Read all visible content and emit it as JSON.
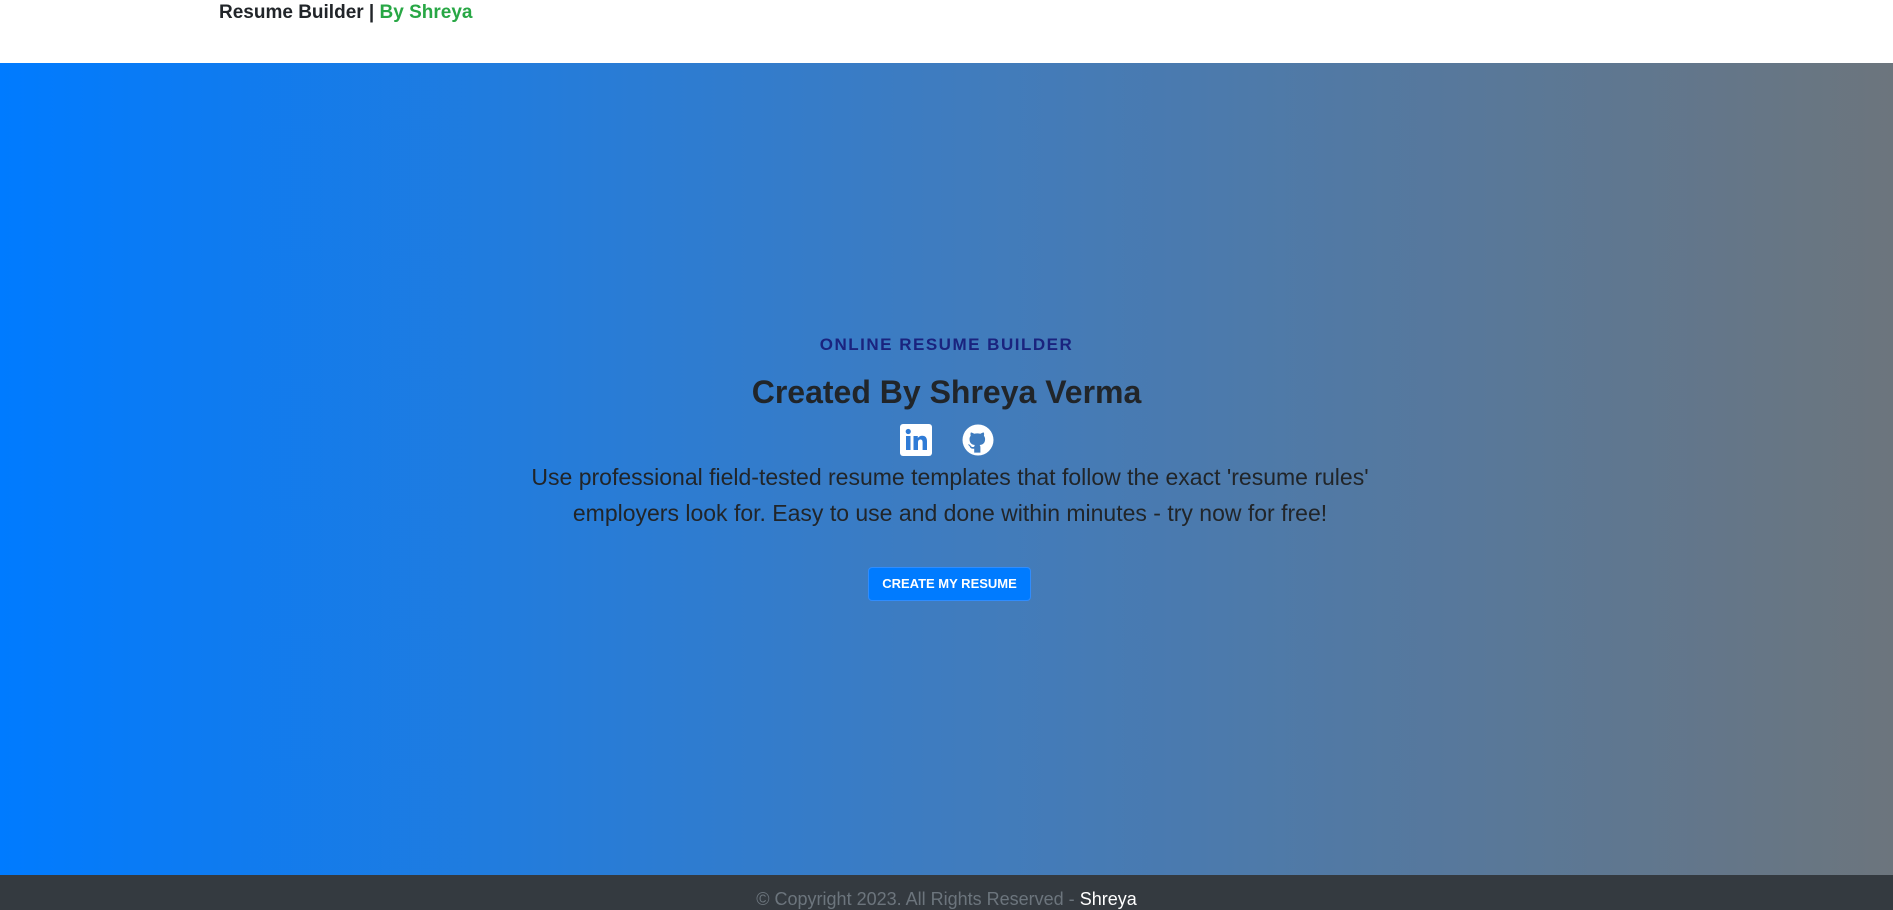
{
  "navbar": {
    "brand_main": "Resume Builder | ",
    "brand_accent": "By Shreya"
  },
  "hero": {
    "eyebrow": "ONLINE RESUME BUILDER",
    "headline": "Created By Shreya Verma",
    "description_line1": "Use professional field-tested resume templates that follow the exact 'resume rules'",
    "description_line2": "employers look for. Easy to use and done within minutes - try now for free!",
    "cta_label": "CREATE MY RESUME",
    "socials": [
      {
        "icon": "linkedin-icon"
      },
      {
        "icon": "github-icon"
      }
    ]
  },
  "footer": {
    "copyright": "© Copyright 2023. All Rights Reserved - ",
    "owner": "Shreya"
  },
  "colors": {
    "accent_green": "#28a745",
    "primary_blue": "#007bff",
    "gradient_end": "#6c757d",
    "footer_bg": "#343a40",
    "eyebrow": "#1a237e"
  }
}
